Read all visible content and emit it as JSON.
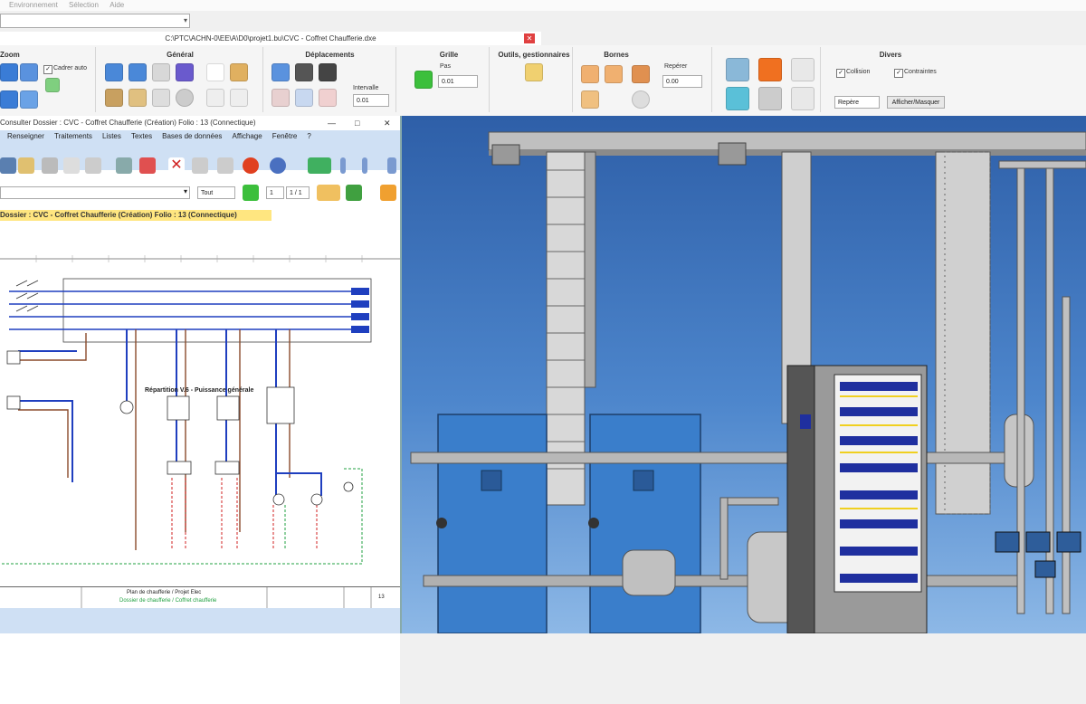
{
  "menubar": [
    "Environnement",
    "Sélection",
    "Aide"
  ],
  "window_title": "C:\\PTC\\ACHN-0\\EE\\A\\D0\\projet1.bu\\CVC - Coffret Chaufferie.dxe",
  "ribbon": {
    "group_zoom": "Zoom",
    "cadrer_auto": "Cadrer auto",
    "group_general": "Général",
    "group_deplacements": "Déplacements",
    "intervalle_label": "Intervalle",
    "intervalle_value": "0.01",
    "group_grille": "Grille",
    "pas_label": "Pas",
    "pas_value": "0.01",
    "group_outils": "Outils, gestionnaires",
    "group_bornes": "Bornes",
    "reperer_label": "Repérer",
    "reperer_value": "0.00",
    "group_divers": "Divers",
    "collision_label": "Collision",
    "contraintes_label": "Contraintes",
    "repere_value": "Repère",
    "afficher_masquer": "Afficher/Masquer"
  },
  "left_window": {
    "title": "Consulter Dossier : CVC - Coffret Chaufferie (Création) Folio : 13 (Connectique)",
    "menu": [
      "Renseigner",
      "Traitements",
      "Listes",
      "Textes",
      "Bases de données",
      "Affichage",
      "Fenêtre",
      "?"
    ],
    "filter_value": "Tout",
    "page_current": "1",
    "page_total": "1 / 1",
    "path": "Dossier : CVC - Coffret Chaufferie (Création) Folio : 13 (Connectique)",
    "sheet_title": "Répartition V.6 - Puissance générale",
    "footer_text1": "Plan de chaufferie / Projet Elec",
    "footer_text2": "Dossier de chaufferie / Coffret chaufferie",
    "footer_text3": "13"
  },
  "colors": {
    "ribbon_bg": "#f5f5f5",
    "doc_menu_bg": "#cfe0f4",
    "path_bar": "#ffe680",
    "wire_blue": "#1f3fbf",
    "wire_brown": "#8a4a2a",
    "wire_red": "#d02020",
    "wire_green": "#20a040",
    "view_sky_top": "#2e5fa8",
    "view_sky_bottom": "#8db8e6"
  }
}
